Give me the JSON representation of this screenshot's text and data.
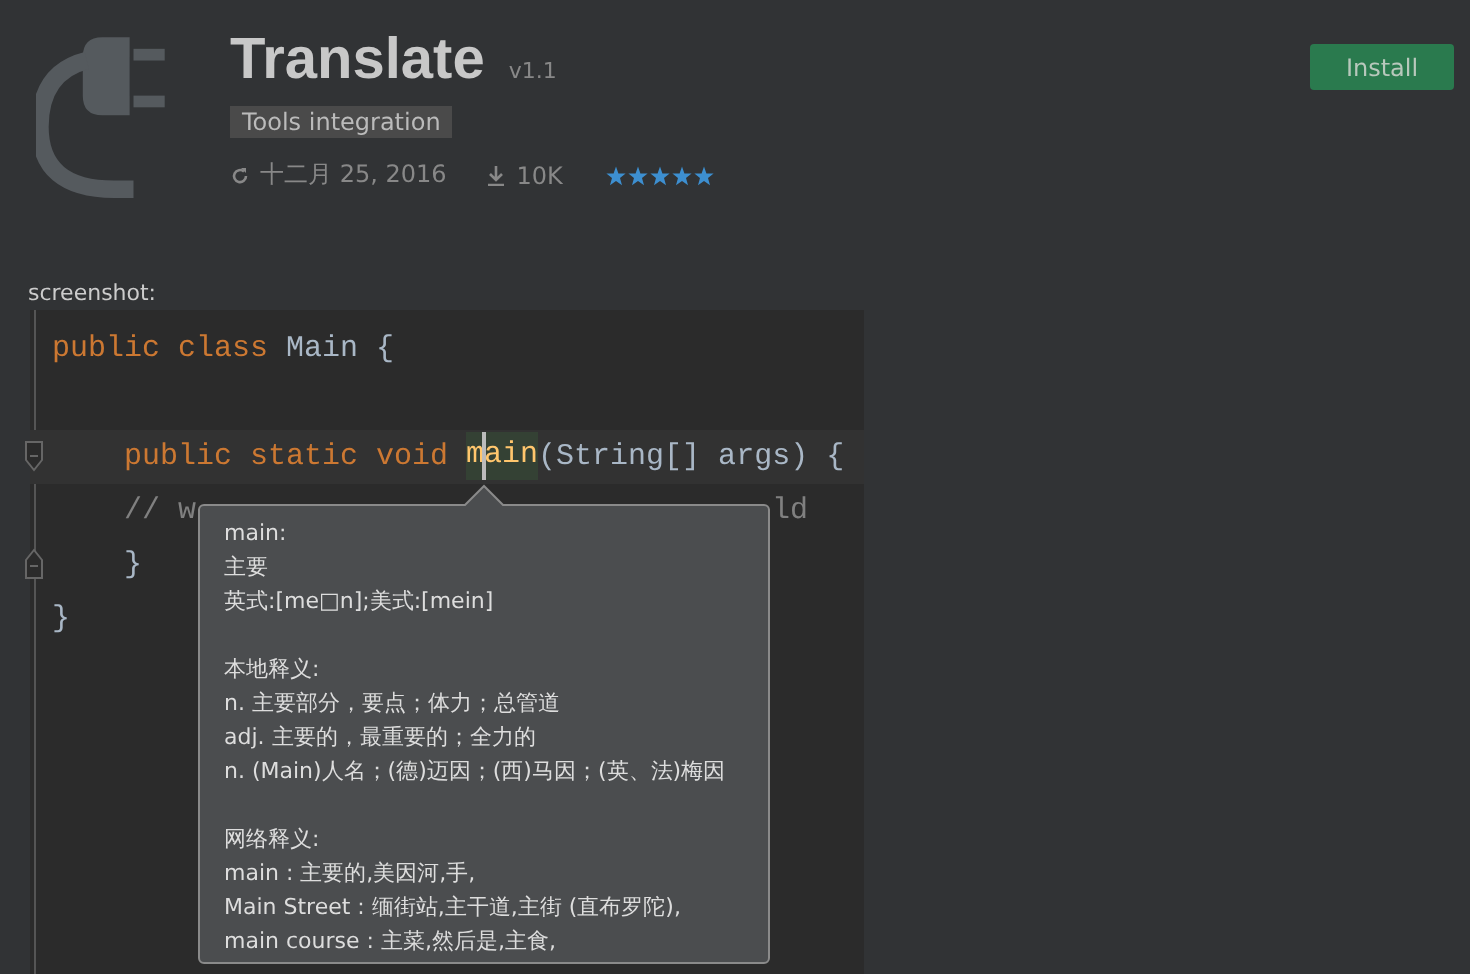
{
  "plugin": {
    "name": "Translate",
    "version": "v1.1",
    "category": "Tools integration",
    "date": "十二月 25, 2016",
    "downloads": "10K",
    "stars": 5
  },
  "install_button": "Install",
  "screenshot": {
    "label": "screenshot:",
    "code_lines": [
      {
        "indented": false,
        "current": false,
        "tokens": [
          {
            "kind": "keyword",
            "text": "public class "
          },
          {
            "kind": "plain",
            "text": "Main {"
          }
        ]
      },
      {
        "current": false
      },
      {
        "kind": "fold_start",
        "indented": true,
        "current": true,
        "tokens": [
          {
            "kind": "keyword",
            "text": "public static void "
          },
          {
            "kind": "usage",
            "text": "main"
          },
          {
            "kind": "plain",
            "text": "(String[] args) {"
          }
        ]
      },
      {
        "indented": true,
        "current": false,
        "tokens": [
          {
            "kind": "comment",
            "text": "// w"
          },
          {
            "kind": "comment_tail",
            "text": "ld"
          }
        ]
      },
      {
        "kind": "fold_end",
        "indented": true,
        "current": false,
        "tokens": [
          {
            "kind": "plain",
            "text": "}"
          }
        ]
      },
      {
        "indented": false,
        "current": false,
        "tokens": [
          {
            "kind": "plain",
            "text": "}"
          }
        ]
      }
    ],
    "tooltip": {
      "groups": [
        [
          "main:",
          "主要",
          "英式:[me□n];美式:[mein]"
        ],
        [
          "本地释义:",
          "n. 主要部分，要点；体力；总管道",
          "adj. 主要的，最重要的；全力的",
          "n. (Main)人名；(德)迈因；(西)马因；(英、法)梅因"
        ],
        [
          "网络释义:",
          "main : 主要的,美因河,手,",
          "Main Street : 缅街站,主干道,主街 (直布罗陀),",
          "main course : 主菜,然后是,主食,"
        ]
      ]
    }
  }
}
